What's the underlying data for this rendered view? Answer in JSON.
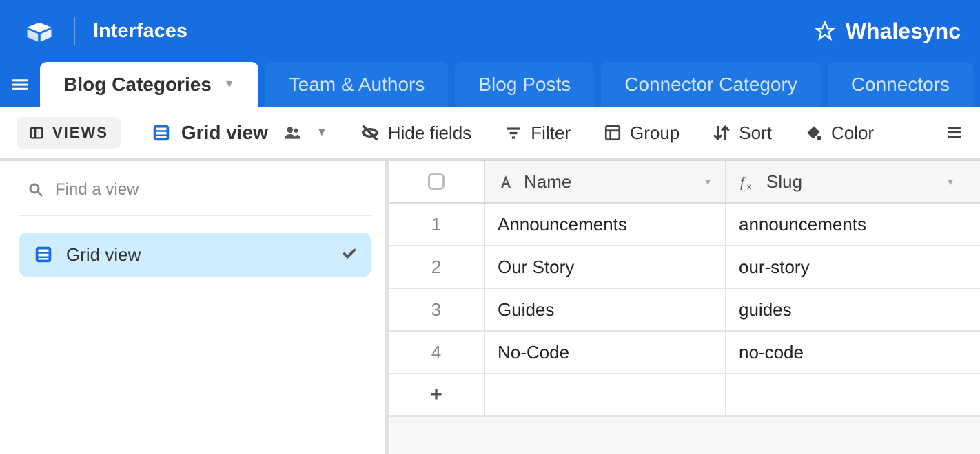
{
  "header": {
    "section": "Interfaces",
    "base_name": "Whalesync"
  },
  "tabs": [
    {
      "label": "Blog Categories",
      "active": true
    },
    {
      "label": "Team & Authors",
      "active": false
    },
    {
      "label": "Blog Posts",
      "active": false
    },
    {
      "label": "Connector Category",
      "active": false
    },
    {
      "label": "Connectors",
      "active": false
    }
  ],
  "toolbar": {
    "views_label": "VIEWS",
    "current_view": "Grid view",
    "hide_fields": "Hide fields",
    "filter": "Filter",
    "group": "Group",
    "sort": "Sort",
    "color": "Color"
  },
  "left_panel": {
    "search_placeholder": "Find a view",
    "view_item_label": "Grid view"
  },
  "table": {
    "columns": [
      {
        "key": "name",
        "label": "Name",
        "type": "text"
      },
      {
        "key": "slug",
        "label": "Slug",
        "type": "formula"
      }
    ],
    "rows": [
      {
        "n": "1",
        "name": "Announcements",
        "slug": "announcements"
      },
      {
        "n": "2",
        "name": "Our Story",
        "slug": "our-story"
      },
      {
        "n": "3",
        "name": "Guides",
        "slug": "guides"
      },
      {
        "n": "4",
        "name": "No-Code",
        "slug": "no-code"
      }
    ],
    "add_row_symbol": "+"
  }
}
